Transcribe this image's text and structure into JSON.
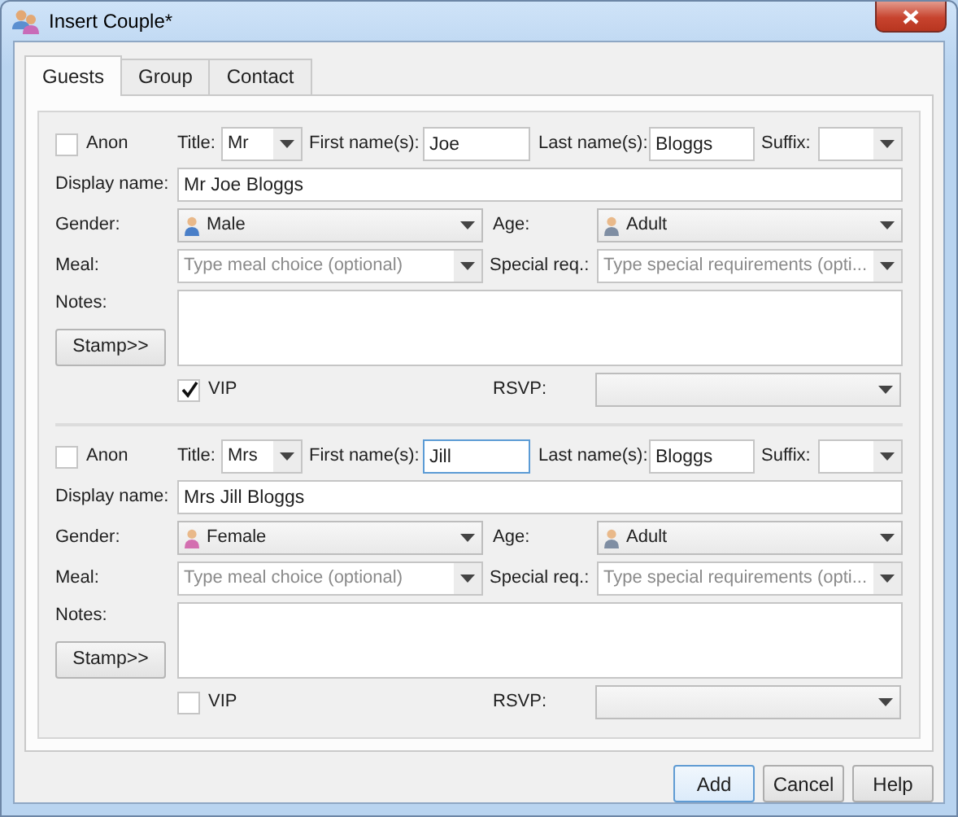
{
  "window": {
    "title": "Insert Couple*"
  },
  "tabs": [
    {
      "label": "Guests",
      "selected": true
    },
    {
      "label": "Group",
      "selected": false
    },
    {
      "label": "Contact",
      "selected": false
    }
  ],
  "guests": [
    {
      "anon": {
        "label": "Anon",
        "checked": false
      },
      "title": {
        "label": "Title:",
        "value": "Mr"
      },
      "first_name": {
        "label": "First name(s):",
        "value": "Joe",
        "focused": false
      },
      "last_name": {
        "label": "Last name(s):",
        "value": "Bloggs"
      },
      "suffix": {
        "label": "Suffix:"
      },
      "display_name": {
        "label": "Display name:",
        "value": "Mr Joe Bloggs"
      },
      "gender": {
        "label": "Gender:",
        "value": "Male",
        "color": "#4a7fc8"
      },
      "age": {
        "label": "Age:",
        "value": "Adult",
        "color": "#7f8ea3"
      },
      "meal": {
        "label": "Meal:",
        "placeholder": "Type meal choice (optional)"
      },
      "special_req": {
        "label": "Special req.:",
        "placeholder": "Type special requirements (opti..."
      },
      "notes": {
        "label": "Notes:"
      },
      "stamp": "Stamp>>",
      "vip": {
        "label": "VIP",
        "checked": true
      },
      "rsvp": {
        "label": "RSVP:"
      }
    },
    {
      "anon": {
        "label": "Anon",
        "checked": false
      },
      "title": {
        "label": "Title:",
        "value": "Mrs"
      },
      "first_name": {
        "label": "First name(s):",
        "value": "Jill",
        "focused": true
      },
      "last_name": {
        "label": "Last name(s):",
        "value": "Bloggs"
      },
      "suffix": {
        "label": "Suffix:"
      },
      "display_name": {
        "label": "Display name:",
        "value": "Mrs Jill Bloggs"
      },
      "gender": {
        "label": "Gender:",
        "value": "Female",
        "color": "#d36fb0"
      },
      "age": {
        "label": "Age:",
        "value": "Adult",
        "color": "#7f8ea3"
      },
      "meal": {
        "label": "Meal:",
        "placeholder": "Type meal choice (optional)"
      },
      "special_req": {
        "label": "Special req.:",
        "placeholder": "Type special requirements (opti..."
      },
      "notes": {
        "label": "Notes:"
      },
      "stamp": "Stamp>>",
      "vip": {
        "label": "VIP",
        "checked": false
      },
      "rsvp": {
        "label": "RSVP:"
      }
    }
  ],
  "buttons": [
    {
      "label": "Add",
      "default": true
    },
    {
      "label": "Cancel",
      "default": false
    },
    {
      "label": "Help",
      "default": false
    }
  ]
}
